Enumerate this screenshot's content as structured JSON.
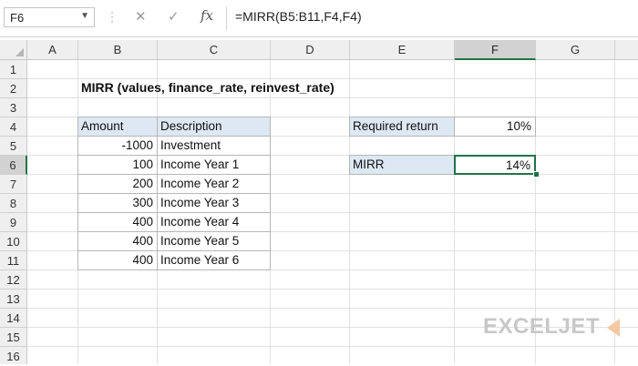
{
  "formula_bar": {
    "name_box": "F6",
    "cancel_glyph": "✕",
    "enter_glyph": "✓",
    "fx_label": "fx",
    "formula": "=MIRR(B5:B11,F4,F4)"
  },
  "columns": [
    "A",
    "B",
    "C",
    "D",
    "E",
    "F",
    "G"
  ],
  "rows": [
    "1",
    "2",
    "3",
    "4",
    "5",
    "6",
    "7",
    "8",
    "9",
    "10",
    "11",
    "12",
    "13",
    "14",
    "15",
    "16"
  ],
  "selection": {
    "column": "F",
    "row": "6"
  },
  "sheet": {
    "title": "MIRR (values, finance_rate, reinvest_rate)",
    "table": {
      "headers": [
        "Amount",
        "Description"
      ],
      "rows": [
        {
          "amount": "-1000",
          "description": "Investment"
        },
        {
          "amount": "100",
          "description": "Income Year 1"
        },
        {
          "amount": "200",
          "description": "Income Year 2"
        },
        {
          "amount": "300",
          "description": "Income Year 3"
        },
        {
          "amount": "400",
          "description": "Income Year 4"
        },
        {
          "amount": "400",
          "description": "Income Year 5"
        },
        {
          "amount": "400",
          "description": "Income Year 6"
        }
      ]
    },
    "required_return": {
      "label": "Required return",
      "value": "10%"
    },
    "mirr": {
      "label": "MIRR",
      "value": "14%"
    }
  },
  "watermark": {
    "text": "EXCELJET"
  },
  "colors": {
    "accent": "#217346",
    "header_fill": "#dde8f3"
  }
}
